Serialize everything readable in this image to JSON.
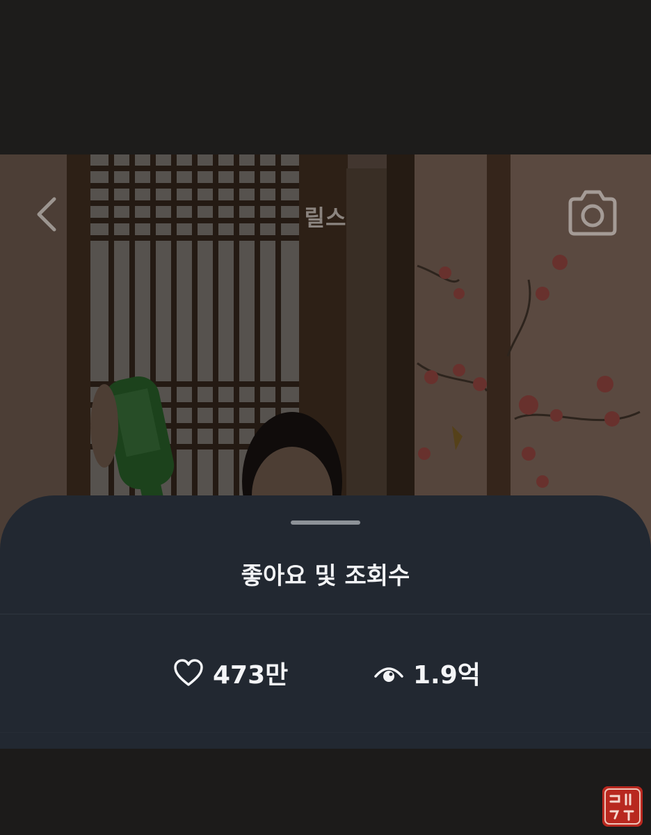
{
  "header": {
    "title": "릴스",
    "back_icon": "chevron-left-icon",
    "camera_icon": "camera-icon"
  },
  "sheet": {
    "title": "좋아요 및 조회수",
    "likes": {
      "icon": "heart-icon",
      "value": "473만"
    },
    "views": {
      "icon": "eye-icon",
      "value": "1.9억"
    }
  },
  "watermark": {
    "text": "골드검지",
    "color": "#b8281f"
  },
  "colors": {
    "sheet_background": "#222831",
    "text_primary": "#f2f3f5",
    "handle": "#8d9298"
  }
}
